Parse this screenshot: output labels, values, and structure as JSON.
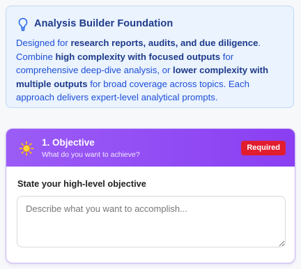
{
  "info": {
    "title": "Analysis Builder Foundation",
    "body": [
      {
        "text": "Designed for ",
        "bold": false
      },
      {
        "text": "research reports, audits, and due diligence",
        "bold": true
      },
      {
        "text": ". Combine ",
        "bold": false
      },
      {
        "text": "high complexity with focused outputs",
        "bold": true
      },
      {
        "text": " for comprehensive deep-dive analysis, or ",
        "bold": false
      },
      {
        "text": "lower complexity with multiple outputs",
        "bold": true
      },
      {
        "text": " for broad coverage across topics. Each approach delivers expert-level analytical prompts.",
        "bold": false
      }
    ],
    "icon": "lightbulb-icon"
  },
  "step": {
    "title": "1. Objective",
    "subtitle": "What do you want to achieve?",
    "badge": "Required",
    "icon": "sun-icon",
    "field_label": "State your high-level objective",
    "input_value": "",
    "input_placeholder": "Describe what you want to accomplish..."
  },
  "colors": {
    "info_bg": "#eaf3fe",
    "info_text": "#1d4ed8",
    "header_gradient_start": "#9b5cf6",
    "header_gradient_end": "#8a3ff2",
    "badge_red": "#e11d2e"
  }
}
